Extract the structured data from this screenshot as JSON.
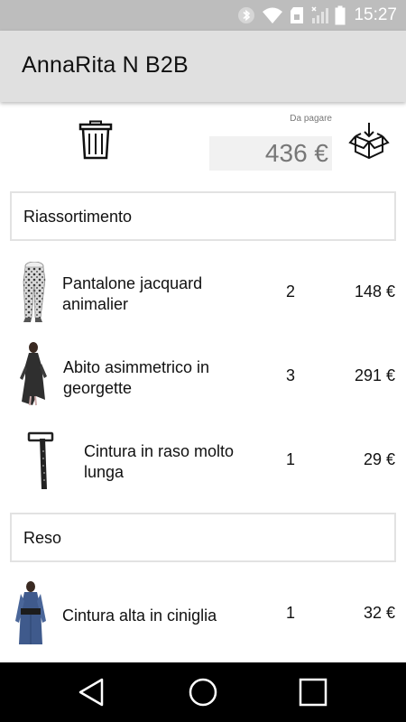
{
  "status_bar": {
    "time": "15:27",
    "icons": [
      "bluetooth-icon",
      "wifi-icon",
      "sd-card-icon",
      "signal-icon",
      "battery-icon"
    ]
  },
  "app_bar": {
    "title": "AnnaRita N B2B"
  },
  "summary": {
    "label": "Da pagare",
    "amount": "436 €",
    "actions": [
      "trash-icon",
      "download-box-icon"
    ]
  },
  "sections": [
    {
      "title": "Riassortimento",
      "items": [
        {
          "name": "Pantalone jacquard animalier",
          "qty": "2",
          "price": "148 €",
          "image": "patterned-trousers"
        },
        {
          "name": "Abito asimmetrico in georgette",
          "qty": "3",
          "price": "291 €",
          "image": "black-dress"
        },
        {
          "name": "Cintura in raso molto lunga",
          "qty": "1",
          "price": "29 €",
          "image": "black-belt"
        }
      ]
    },
    {
      "title": "Reso",
      "items": [
        {
          "name": "Cintura alta in ciniglia",
          "qty": "1",
          "price": "32 €",
          "image": "blue-outfit-with-belt"
        }
      ]
    }
  ],
  "nav_bar": {
    "buttons": [
      "back-icon",
      "home-icon",
      "recents-icon"
    ]
  },
  "colors": {
    "status_bar": "#bdbdbd",
    "app_bar": "#e0e0e0",
    "nav_bar": "#000000",
    "amount_box": "#f1f1f1"
  }
}
